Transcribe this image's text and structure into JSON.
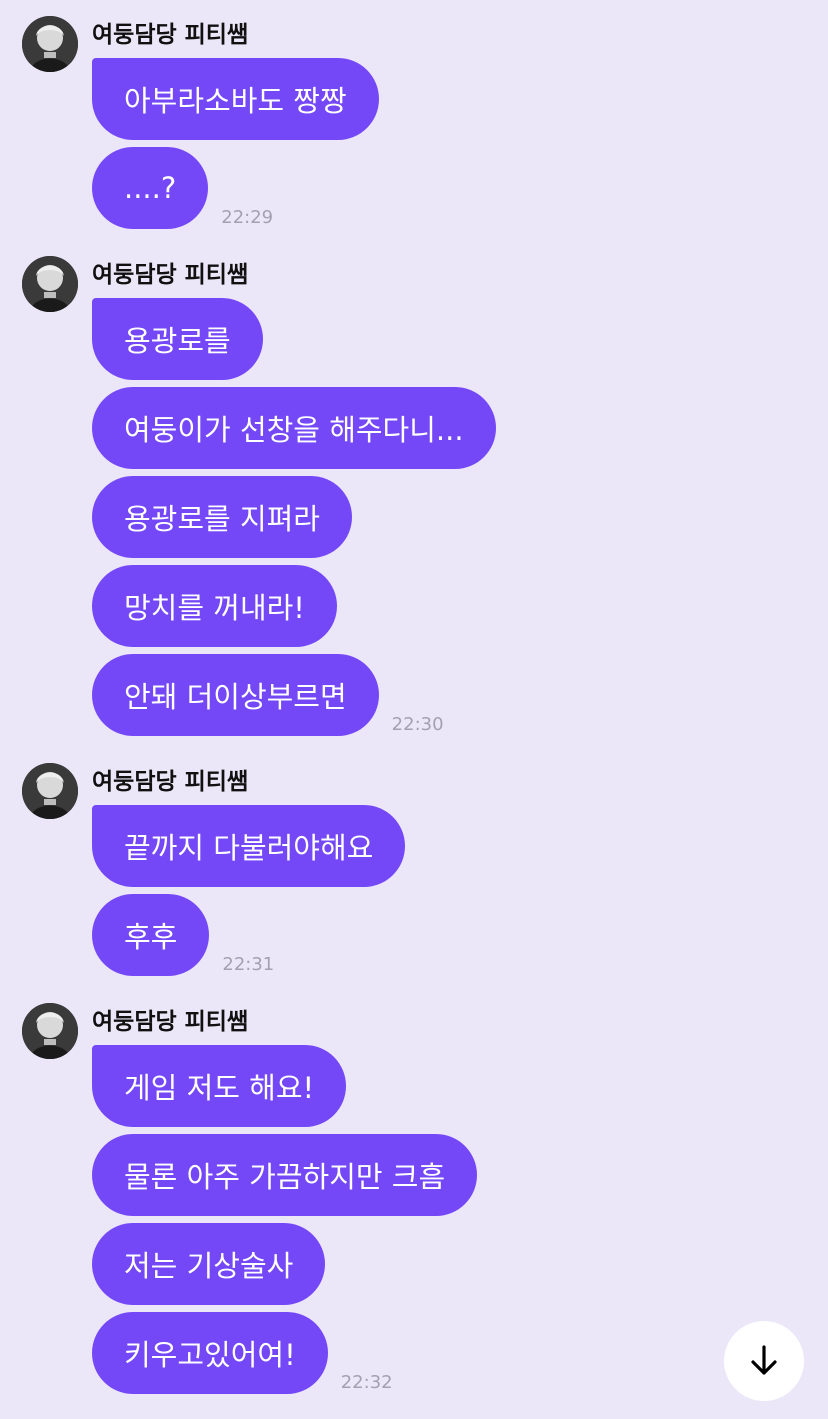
{
  "messages": [
    {
      "sender": "여둥담당 피티쌤",
      "bubbles": [
        "아부라소바도 짱짱",
        "....?"
      ],
      "time": "22:29"
    },
    {
      "sender": "여둥담당 피티쌤",
      "bubbles": [
        "용광로를",
        "여둥이가 선창을 해주다니...",
        "용광로를 지펴라",
        "망치를 꺼내라!",
        "안돼 더이상부르면"
      ],
      "time": "22:30"
    },
    {
      "sender": "여둥담당 피티쌤",
      "bubbles": [
        "끝까지 다불러야해요",
        "후후"
      ],
      "time": "22:31"
    },
    {
      "sender": "여둥담당 피티쌤",
      "bubbles": [
        "게임 저도 해요!",
        "물론 아주 가끔하지만 크흠",
        "저는 기상술사",
        "키우고있어여!"
      ],
      "time": "22:32"
    }
  ],
  "colors": {
    "background": "#ece7f8",
    "bubble": "#7448f7",
    "bubble_text": "#ffffff",
    "timestamp": "#a49fb3",
    "sender": "#111111"
  },
  "icons": {
    "avatar": "profile-photo",
    "scroll_button": "arrow-down-icon"
  }
}
